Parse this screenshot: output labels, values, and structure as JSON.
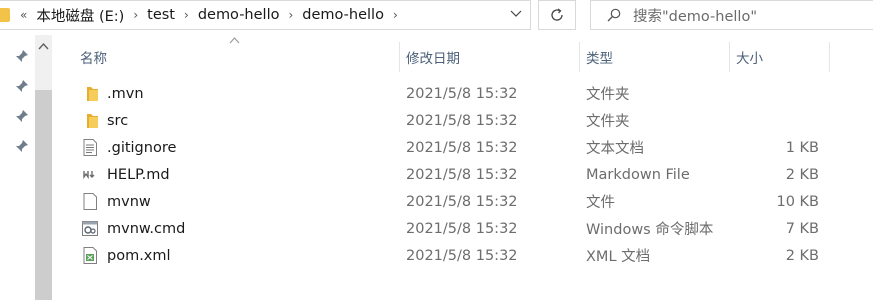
{
  "breadcrumb": {
    "overflow": "«",
    "items": [
      "本地磁盘 (E:)",
      "test",
      "demo-hello",
      "demo-hello"
    ]
  },
  "search": {
    "placeholder": "搜索\"demo-hello\""
  },
  "columns": {
    "name": "名称",
    "modified": "修改日期",
    "type": "类型",
    "size": "大小"
  },
  "files": [
    {
      "name": ".mvn",
      "modified": "2021/5/8 15:32",
      "type": "文件夹",
      "size": "",
      "icon": "folder-icon"
    },
    {
      "name": "src",
      "modified": "2021/5/8 15:32",
      "type": "文件夹",
      "size": "",
      "icon": "folder-icon"
    },
    {
      "name": ".gitignore",
      "modified": "2021/5/8 15:32",
      "type": "文本文档",
      "size": "1 KB",
      "icon": "text-file-icon"
    },
    {
      "name": "HELP.md",
      "modified": "2021/5/8 15:32",
      "type": "Markdown File",
      "size": "2 KB",
      "icon": "markdown-file-icon"
    },
    {
      "name": "mvnw",
      "modified": "2021/5/8 15:32",
      "type": "文件",
      "size": "10 KB",
      "icon": "blank-file-icon"
    },
    {
      "name": "mvnw.cmd",
      "modified": "2021/5/8 15:32",
      "type": "Windows 命令脚本",
      "size": "7 KB",
      "icon": "cmd-script-icon"
    },
    {
      "name": "pom.xml",
      "modified": "2021/5/8 15:32",
      "type": "XML 文档",
      "size": "2 KB",
      "icon": "xml-file-icon"
    }
  ],
  "colors": {
    "header_text": "#4c607a",
    "folder": "#f2c249",
    "secondary_text": "#6d6d6d"
  }
}
